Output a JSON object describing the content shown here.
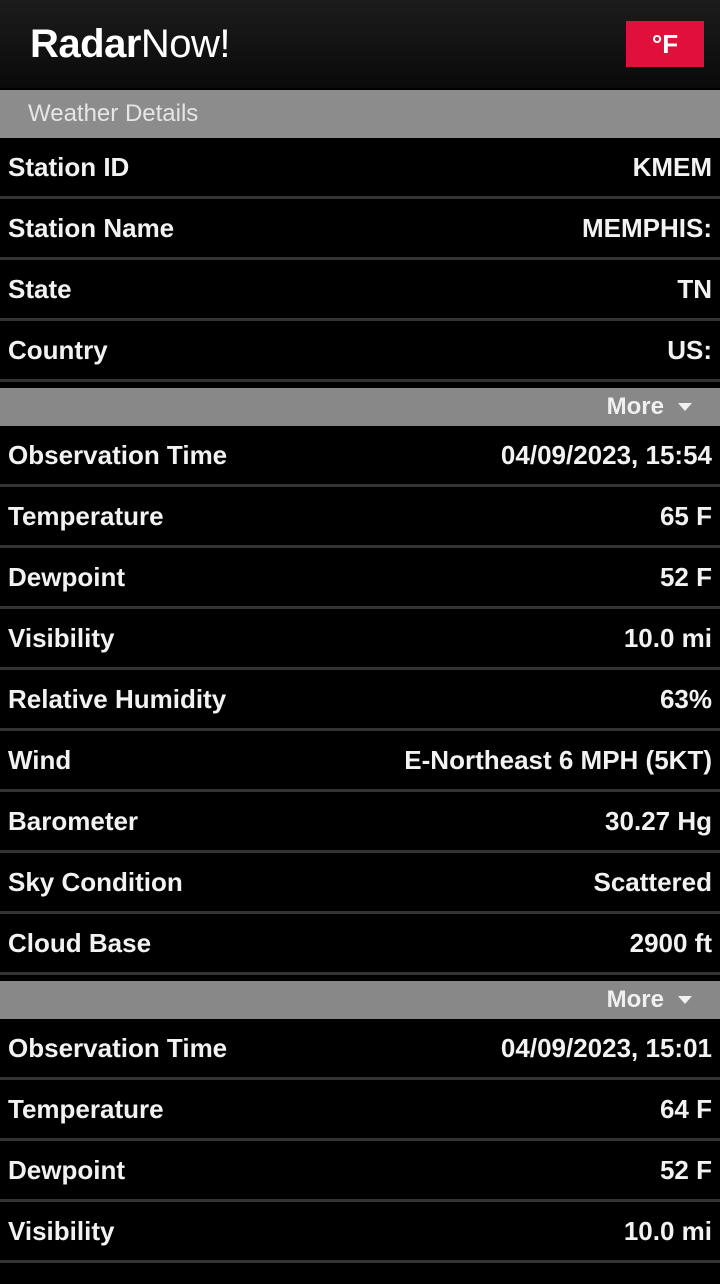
{
  "header": {
    "brand_bold": "Radar",
    "brand_thin": "Now!",
    "unit_label": "°F"
  },
  "section": {
    "title": "Weather Details"
  },
  "station": [
    {
      "label": "Station ID",
      "value": "KMEM"
    },
    {
      "label": "Station Name",
      "value": "MEMPHIS:"
    },
    {
      "label": "State",
      "value": "TN"
    },
    {
      "label": "Country",
      "value": "US:"
    }
  ],
  "more_label": "More",
  "observations": [
    [
      {
        "label": "Observation Time",
        "value": "04/09/2023, 15:54"
      },
      {
        "label": "Temperature",
        "value": "65 F"
      },
      {
        "label": "Dewpoint",
        "value": "52 F"
      },
      {
        "label": "Visibility",
        "value": "10.0 mi"
      },
      {
        "label": "Relative Humidity",
        "value": "63%"
      },
      {
        "label": "Wind",
        "value": "E-Northeast 6 MPH (5KT)"
      },
      {
        "label": "Barometer",
        "value": "30.27 Hg"
      },
      {
        "label": "Sky Condition",
        "value": "Scattered"
      },
      {
        "label": "Cloud Base",
        "value": "2900 ft"
      }
    ],
    [
      {
        "label": "Observation Time",
        "value": "04/09/2023, 15:01"
      },
      {
        "label": "Temperature",
        "value": "64 F"
      },
      {
        "label": "Dewpoint",
        "value": "52 F"
      },
      {
        "label": "Visibility",
        "value": "10.0 mi"
      }
    ]
  ]
}
